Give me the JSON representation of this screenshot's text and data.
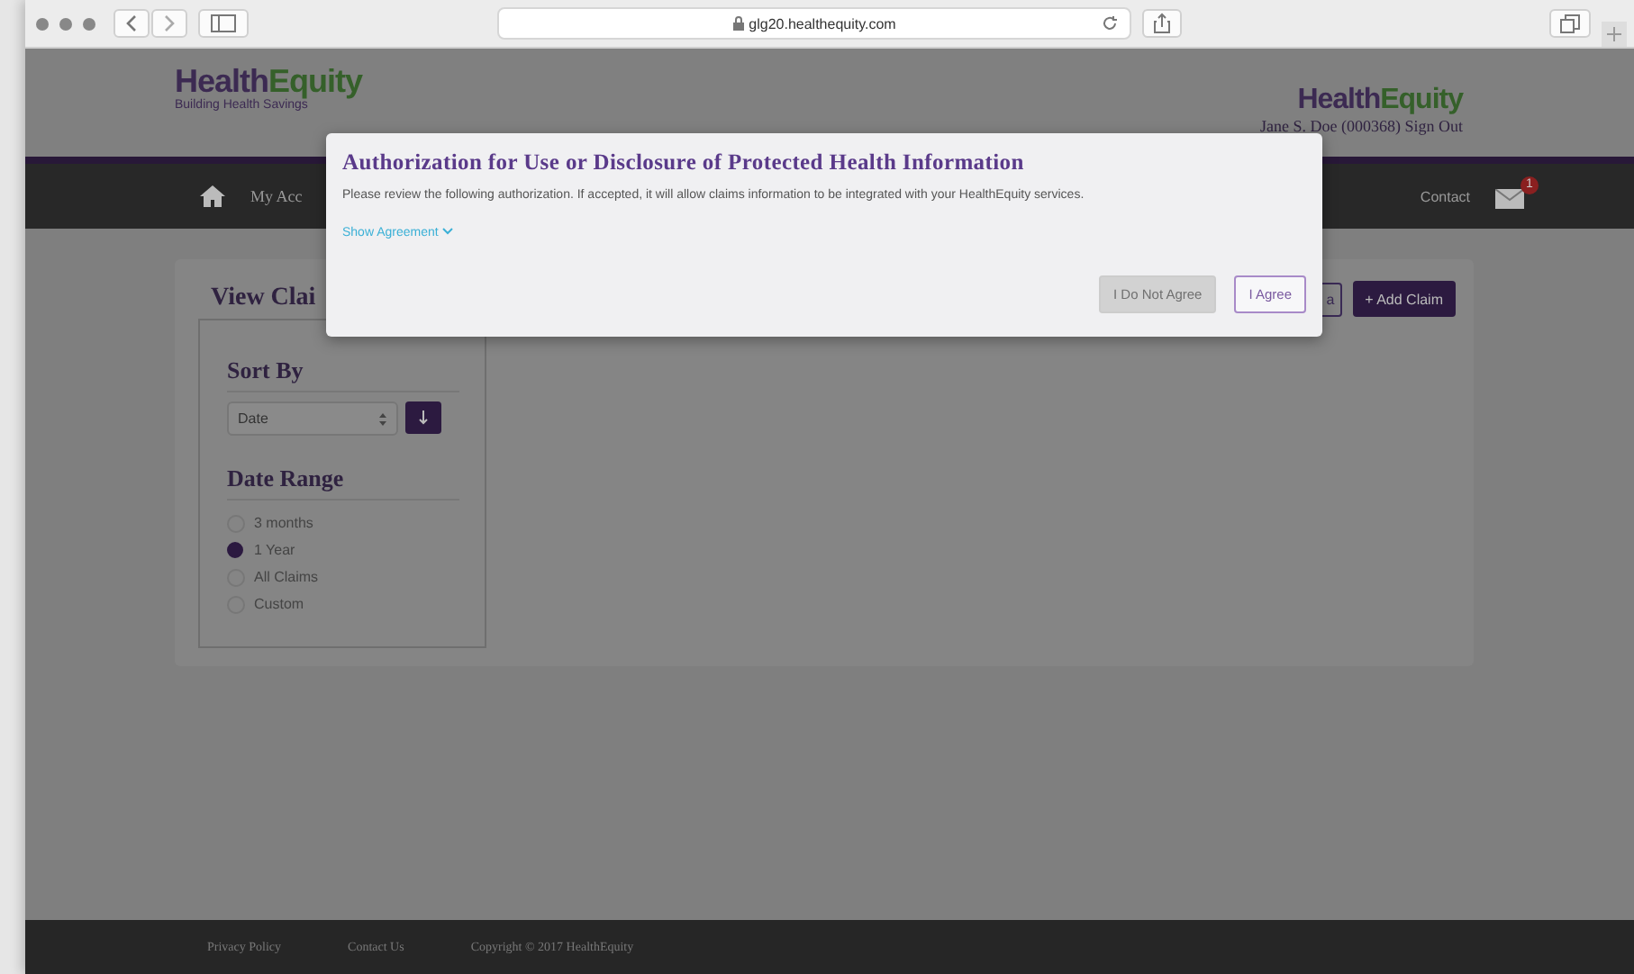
{
  "browser": {
    "url": "glg20.healthequity.com"
  },
  "header": {
    "logo_left": {
      "part1": "Health",
      "part2": "Equity",
      "tagline": "Building Health Savings"
    },
    "logo_right": {
      "part1": "Health",
      "part2": "Equity"
    },
    "user": "Jane S. Doe (000368)",
    "sign_out": "Sign Out"
  },
  "nav": {
    "items": [
      "My Acc"
    ],
    "contact": "Contact",
    "mail_badge": "1"
  },
  "page": {
    "title": "View Clai",
    "partial_button": "a",
    "add_button": "+ Add Claim"
  },
  "sidebar": {
    "sort_heading": "Sort By",
    "sort_value": "Date",
    "range_heading": "Date Range",
    "ranges": [
      {
        "label": "3 months",
        "selected": false
      },
      {
        "label": "1 Year",
        "selected": true
      },
      {
        "label": "All Claims",
        "selected": false
      },
      {
        "label": "Custom",
        "selected": false
      }
    ]
  },
  "modal": {
    "title": "Authorization for Use or Disclosure of Protected Health Information",
    "text": "Please review the following authorization. If accepted, it will allow claims information to be integrated with your HealthEquity services.",
    "link": "Show Agreement",
    "buttons": [
      {
        "label": "I Do Not Agree",
        "disabled": true
      },
      {
        "label": "I Agree",
        "disabled": false
      }
    ]
  },
  "footer": [
    "Privacy Policy",
    "Contact Us",
    "Copyright © 2017 HealthEquity"
  ]
}
